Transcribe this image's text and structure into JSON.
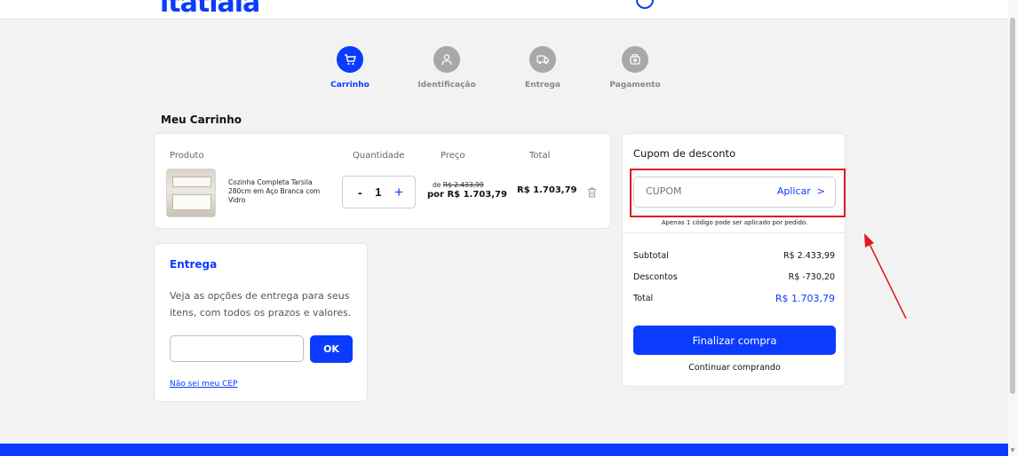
{
  "header": {
    "logo_text": "ltatiaia"
  },
  "steps": [
    {
      "label": "Carrinho",
      "icon": "cart-icon",
      "active": true
    },
    {
      "label": "Identificação",
      "icon": "user-icon",
      "active": false
    },
    {
      "label": "Entrega",
      "icon": "truck-icon",
      "active": false
    },
    {
      "label": "Pagamento",
      "icon": "payment-icon",
      "active": false
    }
  ],
  "cart": {
    "title": "Meu Carrinho",
    "columns": {
      "product": "Produto",
      "quantity": "Quantidade",
      "price": "Preço",
      "total": "Total"
    },
    "item": {
      "name": "Cozinha Completa Tarsila 280cm em Aço Branca com Vidro",
      "quantity": "1",
      "qty_minus": "-",
      "qty_plus": "+",
      "price_old_prefix": "de",
      "price_old": "R$ 2.433,99",
      "price_new": "por R$ 1.703,79",
      "total": "R$ 1.703,79"
    }
  },
  "shipping": {
    "title": "Entrega",
    "text": "Veja as opções de entrega para seus itens, com todos os prazos e valores.",
    "cep_placeholder": "",
    "ok_label": "OK",
    "cep_link": "Não sei meu CEP"
  },
  "summary": {
    "coupon_title": "Cupom de desconto",
    "coupon_placeholder": "CUPOM",
    "apply_label": "Aplicar",
    "coupon_note": "Apenas 1 código pode ser aplicado por pedido.",
    "subtotal_label": "Subtotal",
    "subtotal_value": "R$ 2.433,99",
    "discount_label": "Descontos",
    "discount_value": "R$ -730,20",
    "total_label": "Total",
    "total_value": "R$ 1.703,79",
    "checkout_label": "Finalizar compra",
    "continue_label": "Continuar comprando"
  },
  "colors": {
    "brand_blue": "#0a3bff",
    "highlight_red": "#e0181f"
  }
}
